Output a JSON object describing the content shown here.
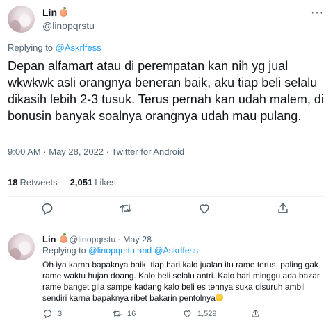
{
  "main_tweet": {
    "name": "Lin",
    "handle": "@linopqrstu",
    "more": "···",
    "replying_prefix": "Replying to",
    "replying_to": "@Askrlfess",
    "text": "Depan alfamart atau di perempatan kan nih yg jual wkwkwk asli orangnya beneran baik, aku tiap beli selalu dikasih lebih 2-3 tusuk. Terus pernah kan udah malem, di bonusin banyak soalnya orangnya udah mau pulang.",
    "meta": "9:00 AM · May 28, 2022 · Twitter for Android",
    "retweets_count": "18",
    "retweets_label": "Retweets",
    "likes_count": "2,051",
    "likes_label": "Likes"
  },
  "reply_tweet": {
    "name": "Lin",
    "handle": "@linopqrstu",
    "date": "· May 28",
    "replying_prefix": "Replying to",
    "replying_to_1": "@linopqrstu",
    "replying_and": "and",
    "replying_to_2": "@Askrlfess",
    "text": "Oh iya karna bapaknya baik, tiap hari kalo jualan itu rame terus, paling gak rame waktu hujan doang. Kalo beli selalu antri. Kalo hari minggu ada bazar rame banget gila sampe kadang kalo beli es tehnya suka disuruh ambil sendiri karna bapaknya ribet bakarin pentolnya",
    "reply_count": "3",
    "retweet_count": "16",
    "like_count": "1,529"
  },
  "icons": {
    "reply": "reply-icon",
    "retweet": "retweet-icon",
    "like": "heart-icon",
    "share": "share-icon",
    "more": "more-icon",
    "emoji_name": "peach-emoji",
    "emoji_laugh": "rofl-emoji"
  },
  "colors": {
    "link": "#1d9bf0",
    "secondary_text": "#536471",
    "primary_text": "#0f1419",
    "divider": "#eff3f4"
  }
}
